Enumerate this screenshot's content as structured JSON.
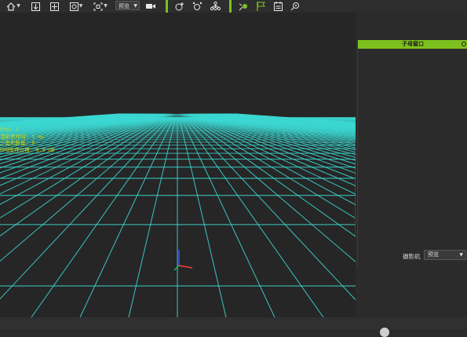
{
  "toolbar": {
    "preview_select": "预览",
    "accent_color": "#7dc11f",
    "icons": [
      "home-icon",
      "import-icon",
      "fit-view-icon",
      "view-mode-icon",
      "frame-select-icon",
      "camera-icon",
      "add-point-icon",
      "transform-icon",
      "hierarchy-icon",
      "path-point-icon",
      "flag-icon",
      "properties-icon",
      "target-icon"
    ]
  },
  "viewport": {
    "grid_color": "#3cd7d2",
    "overlay_lines": [
      "FPS: 3",
      "渲染总时间: 1 ms",
      "三角形数量: 0",
      "GPU显存占用: 0.3 GB"
    ]
  },
  "panel": {
    "title": "子母窗口",
    "camera_label": "摄影机",
    "camera_value": "预览"
  }
}
